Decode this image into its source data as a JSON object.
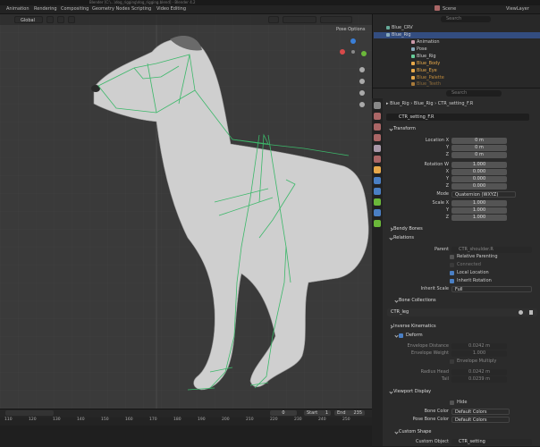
{
  "window": {
    "title": "Blender [C:\\...\\dog_rigging\\dog_rigging.blend] - Blender 4.2"
  },
  "workspaces": [
    "Animation",
    "Rendering",
    "Compositing",
    "Geometry Nodes",
    "Scripting",
    "Video Editing"
  ],
  "topright": {
    "scene": "Scene",
    "view_layer": "ViewLayer"
  },
  "viewport": {
    "orientation": "Global",
    "pose_options": "Pose Options",
    "gizmo": {
      "x": "X",
      "y": "Y",
      "z": "Z"
    }
  },
  "outliner": {
    "search_placeholder": "Search",
    "rows": [
      {
        "name": "Blue_CRV",
        "icon": "curve-icon"
      },
      {
        "name": "Blue_Rig",
        "icon": "armature-icon",
        "selected": true
      },
      {
        "name": "Animation",
        "icon": "animation-icon"
      },
      {
        "name": "Pose",
        "icon": "pose-icon"
      },
      {
        "name": "Blue_Rig",
        "icon": "bone-icon"
      },
      {
        "name": "Blue_Body",
        "icon": "mesh-icon"
      },
      {
        "name": "Blue_Eye",
        "icon": "mesh-icon"
      },
      {
        "name": "Blue_Palette",
        "icon": "mesh-icon"
      },
      {
        "name": "Blue_Teeth",
        "icon": "mesh-icon"
      }
    ]
  },
  "props": {
    "search_placeholder": "Search",
    "breadcrumb": [
      "Blue_Rig",
      "Blue_Rig",
      "CTR_setting_F.R"
    ],
    "bone_name": "CTR_setting_F.R",
    "transform": {
      "title": "Transform",
      "location": {
        "label": "Location X",
        "x": "0 m",
        "y": "0 m",
        "z": "0 m"
      },
      "rotation": {
        "label": "Rotation W",
        "w": "1.000",
        "x": "0.000",
        "y": "0.000",
        "z": "0.000"
      },
      "mode_label": "Mode",
      "mode": "Quaternion (WXYZ)",
      "scale": {
        "label": "Scale X",
        "x": "1.000",
        "y": "1.000",
        "z": "1.000"
      },
      "axis_y": "Y",
      "axis_z": "Z",
      "axis_x": "X"
    },
    "bendy_bones": "Bendy Bones",
    "relations": {
      "title": "Relations",
      "parent_label": "Parent",
      "parent": "CTR_shoulder.R",
      "relative_parenting": "Relative Parenting",
      "connected": "Connected",
      "local_location": "Local Location",
      "inherit_rotation": "Inherit Rotation",
      "inherit_scale_label": "Inherit Scale",
      "inherit_scale": "Full"
    },
    "bone_collections": {
      "title": "Bone Collections",
      "item": "CTR_leg"
    },
    "inverse_kinematics": "Inverse Kinematics",
    "deform": {
      "title": "Deform",
      "env_distance_label": "Envelope Distance",
      "env_distance": "0.0242 m",
      "env_weight_label": "Envelope Weight",
      "env_weight": "1.000",
      "env_multiply": "Envelope Multiply",
      "radius_head_label": "Radius Head",
      "radius_head": "0.0242 m",
      "tail_label": "Tail",
      "tail": "0.0239 m"
    },
    "viewport_display": {
      "title": "Viewport Display",
      "hide": "Hide",
      "bone_color_label": "Bone Color",
      "bone_color": "Default Colors",
      "pose_bone_color_label": "Pose Bone Color",
      "pose_bone_color": "Default Colors"
    },
    "custom_shape": {
      "title": "Custom Shape",
      "custom_object_label": "Custom Object",
      "custom_object": "CTR_setting"
    }
  },
  "timeline": {
    "frame_current": "0",
    "start_label": "Start",
    "start": "1",
    "end_label": "End",
    "end": "235",
    "ticks": [
      "110",
      "120",
      "130",
      "140",
      "150",
      "160",
      "170",
      "180",
      "190",
      "200",
      "210",
      "220",
      "230",
      "240",
      "250"
    ]
  },
  "colors": {
    "accent": "#4a7fc4",
    "bone": "#3cb86a",
    "bg": "#3a3a3a"
  }
}
